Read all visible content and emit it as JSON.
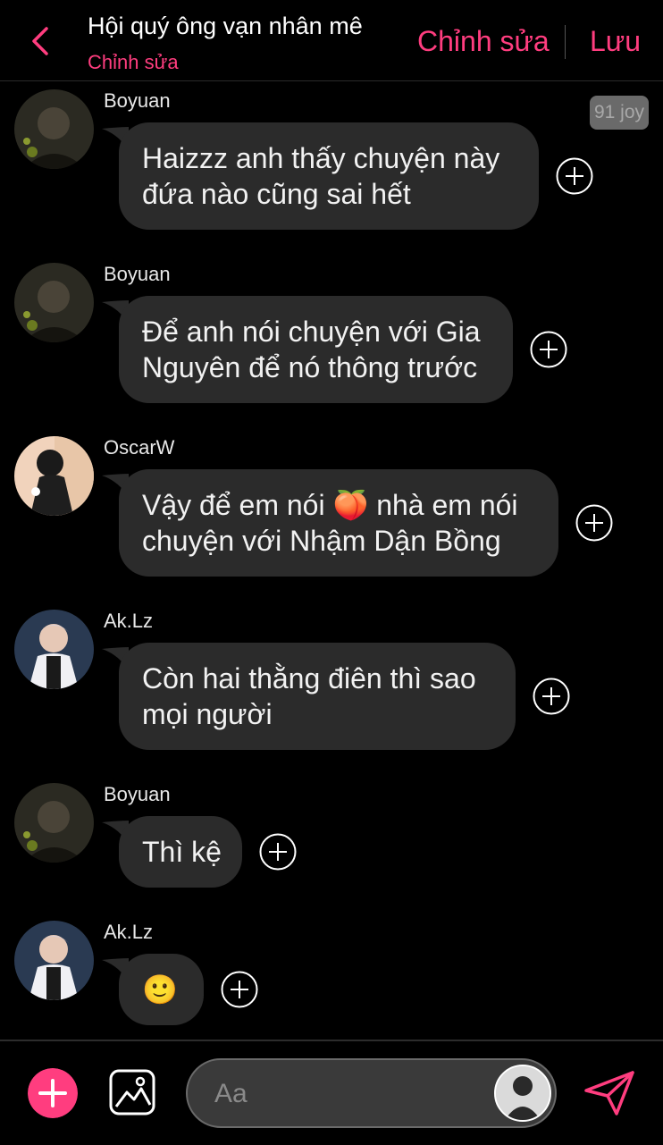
{
  "colors": {
    "accent": "#ff3d7f",
    "bubble": "#2b2b2b",
    "background": "#000000"
  },
  "header": {
    "title": "Hội quý ông vạn nhân mê",
    "subtitle": "Chỉnh sửa",
    "edit_label": "Chỉnh sửa",
    "save_label": "Lưu"
  },
  "badge": {
    "text": "91 joy"
  },
  "messages": [
    {
      "sender": "Boyuan",
      "lines": [
        "Haizzz anh thấy chuyện này",
        "đứa nào cũng sai hết"
      ],
      "avatar": "boyuan-avatar"
    },
    {
      "sender": "Boyuan",
      "lines": [
        "Để anh nói chuyện với Gia",
        "Nguyên để nó thông trước"
      ],
      "avatar": "boyuan-avatar"
    },
    {
      "sender": "OscarW",
      "lines": [
        "Vậy để em nói 🍑 nhà em nói",
        "chuyện với Nhậm Dận Bồng"
      ],
      "avatar": "oscarw-avatar"
    },
    {
      "sender": "Ak.Lz",
      "lines": [
        "Còn hai thằng điên thì sao",
        "mọi người"
      ],
      "avatar": "aklz-avatar"
    },
    {
      "sender": "Boyuan",
      "lines": [
        "Thì kệ"
      ],
      "avatar": "boyuan-avatar"
    },
    {
      "sender": "Ak.Lz",
      "lines": [
        "🙂"
      ],
      "avatar": "aklz-avatar"
    }
  ],
  "composer": {
    "placeholder": "Aa",
    "icons": [
      "plus-icon",
      "image-icon",
      "user-avatar-icon",
      "send-icon"
    ]
  }
}
